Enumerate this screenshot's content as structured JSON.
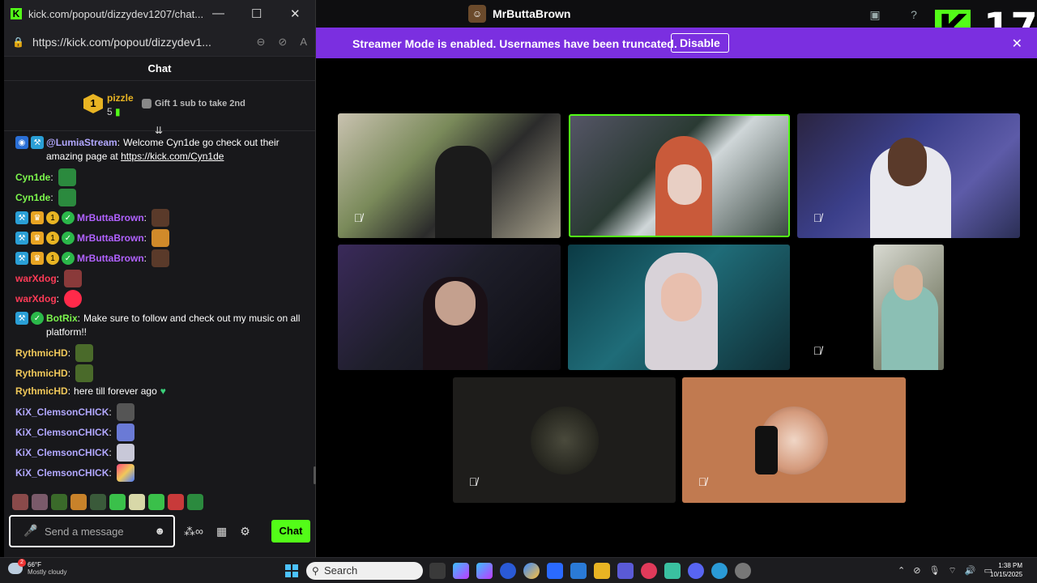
{
  "main_window": {
    "title": "MrButtaBrown",
    "overlay_number": "17",
    "kick_logo": "K"
  },
  "banner": {
    "text": "Streamer Mode is enabled. Usernames have been truncated.",
    "button": "Disable",
    "close": "✕"
  },
  "chat_window": {
    "title": "kick.com/popout/dizzydev1207/chat...",
    "url": "https://kick.com/popout/dizzydev1...",
    "controls": {
      "minimize": "—",
      "maximize": "☐",
      "close": "✕"
    },
    "header": "Chat",
    "pinned": {
      "rank": "1",
      "name": "pizzle",
      "count": "5",
      "gift_text": "Gift 1 sub to take 2nd"
    },
    "messages": [
      {
        "user": "@LumiaStream",
        "color": "#b2a8ff",
        "text": "Welcome Cyn1de go check out their amazing page at ",
        "link": "https://kick.com/Cyn1de"
      },
      {
        "user": "Cyn1de",
        "color": "#7cf54d",
        "text": ""
      },
      {
        "user": "Cyn1de",
        "color": "#7cf54d",
        "text": ""
      },
      {
        "user": "MrButtaBrown",
        "color": "#b162ff",
        "text": ""
      },
      {
        "user": "MrButtaBrown",
        "color": "#b162ff",
        "text": ""
      },
      {
        "user": "MrButtaBrown",
        "color": "#b162ff",
        "text": ""
      },
      {
        "user": "warXdog",
        "color": "#ff3b57",
        "text": ""
      },
      {
        "user": "warXdog",
        "color": "#ff3b57",
        "text": ""
      },
      {
        "user": "BotRix",
        "color": "#7cf54d",
        "text": "Make sure to follow and check out my music on all platform!!"
      },
      {
        "user": "RythmicHD",
        "color": "#f0c85a",
        "text": ""
      },
      {
        "user": "RythmicHD",
        "color": "#f0c85a",
        "text": ""
      },
      {
        "user": "RythmicHD",
        "color": "#f0c85a",
        "text": "here till forever ago"
      },
      {
        "user": "KiX_ClemsonCHICK",
        "color": "#b2a8ff",
        "text": ""
      },
      {
        "user": "KiX_ClemsonCHICK",
        "color": "#b2a8ff",
        "text": ""
      },
      {
        "user": "KiX_ClemsonCHICK",
        "color": "#b2a8ff",
        "text": ""
      },
      {
        "user": "KiX_ClemsonCHICK",
        "color": "#b2a8ff",
        "text": ""
      }
    ],
    "composer_placeholder": "Send a message",
    "chat_button": "Chat"
  },
  "taskbar": {
    "weather_temp": "66°F",
    "weather_desc": "Mostly cloudy",
    "weather_alert": "2",
    "search_label": "Search",
    "time": "1:38 PM",
    "date": "10/15/2025"
  },
  "colors": {
    "kick_green": "#53fc18",
    "banner_purple": "#7b2fe0",
    "chat_bg": "#18181b"
  }
}
